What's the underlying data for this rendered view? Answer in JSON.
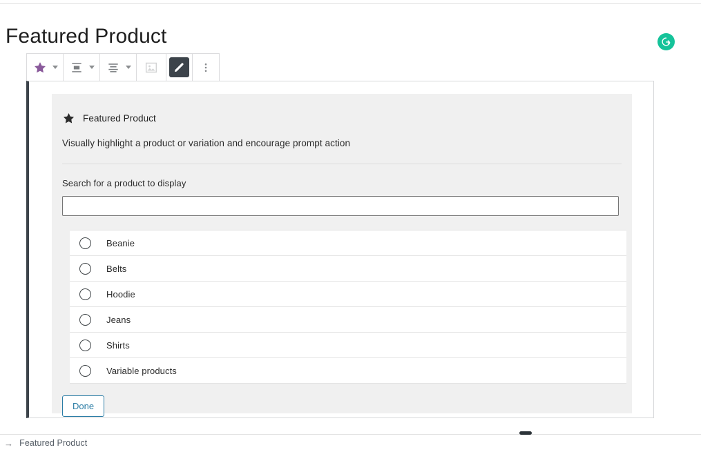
{
  "page": {
    "title": "Featured Product"
  },
  "assistant_badge": {
    "icon": "grammarly-g-icon",
    "color": "#15c39a"
  },
  "toolbar": {
    "items": [
      {
        "name": "block-type-star-button",
        "icon": "star-icon",
        "has_caret": true,
        "active": false,
        "disabled": false,
        "color": "#8a5a9b"
      },
      {
        "name": "change-alignment-button",
        "icon": "align-block-icon",
        "has_caret": true,
        "active": false,
        "disabled": false
      },
      {
        "name": "text-align-button",
        "icon": "align-text-center-icon",
        "has_caret": true,
        "active": false,
        "disabled": false
      },
      {
        "name": "media-button",
        "icon": "image-placeholder-icon",
        "has_caret": false,
        "active": false,
        "disabled": true
      },
      {
        "name": "edit-button",
        "icon": "pencil-icon",
        "has_caret": false,
        "active": true,
        "disabled": false
      },
      {
        "name": "more-options-button",
        "icon": "three-dots-vertical-icon",
        "has_caret": false,
        "active": false,
        "disabled": false
      }
    ]
  },
  "block": {
    "heading": "Featured Product",
    "heading_icon": "star-icon",
    "description": "Visually highlight a product or variation and encourage prompt action",
    "search": {
      "label": "Search for a product to display",
      "value": "",
      "placeholder": ""
    },
    "products": [
      {
        "label": "Beanie",
        "selected": false
      },
      {
        "label": "Belts",
        "selected": false
      },
      {
        "label": "Hoodie",
        "selected": false
      },
      {
        "label": "Jeans",
        "selected": false
      },
      {
        "label": "Shirts",
        "selected": false
      },
      {
        "label": "Variable products",
        "selected": false
      }
    ],
    "done_label": "Done"
  },
  "breadcrumb": {
    "arrow": "→",
    "label": "Featured Product"
  }
}
